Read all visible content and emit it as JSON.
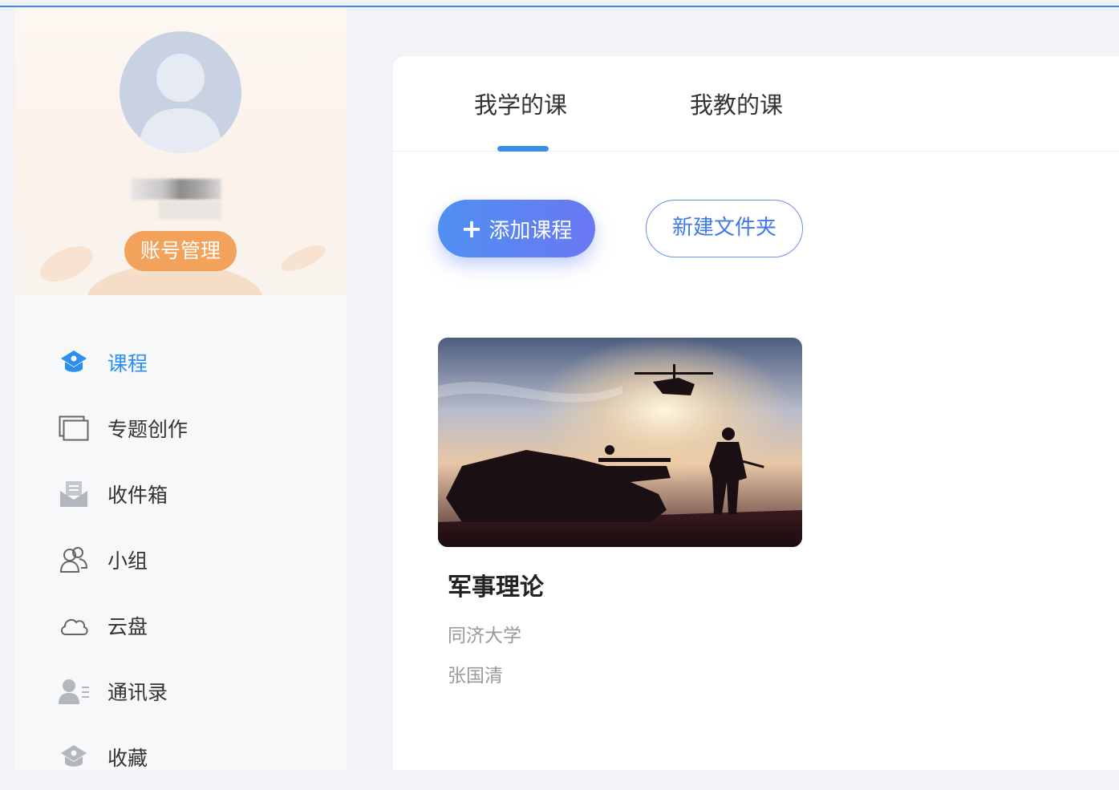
{
  "sidebar": {
    "account_button": "账号管理",
    "items": [
      {
        "label": "课程",
        "icon": "course-icon",
        "active": true
      },
      {
        "label": "专题创作",
        "icon": "topic-icon",
        "active": false
      },
      {
        "label": "收件箱",
        "icon": "inbox-icon",
        "active": false
      },
      {
        "label": "小组",
        "icon": "group-icon",
        "active": false
      },
      {
        "label": "云盘",
        "icon": "cloud-icon",
        "active": false
      },
      {
        "label": "通讯录",
        "icon": "contacts-icon",
        "active": false
      },
      {
        "label": "收藏",
        "icon": "favorite-icon",
        "active": false
      }
    ]
  },
  "main": {
    "tabs": [
      {
        "label": "我学的课",
        "active": true
      },
      {
        "label": "我教的课",
        "active": false
      }
    ],
    "add_course_button": "添加课程",
    "new_folder_button": "新建文件夹",
    "courses": [
      {
        "title": "军事理论",
        "school": "同济大学",
        "teacher": "张国清"
      }
    ]
  },
  "colors": {
    "accent": "#2b8ff0",
    "account_button": "#f2a25a",
    "add_button_from": "#4f8ff2",
    "add_button_to": "#6a78f3"
  }
}
